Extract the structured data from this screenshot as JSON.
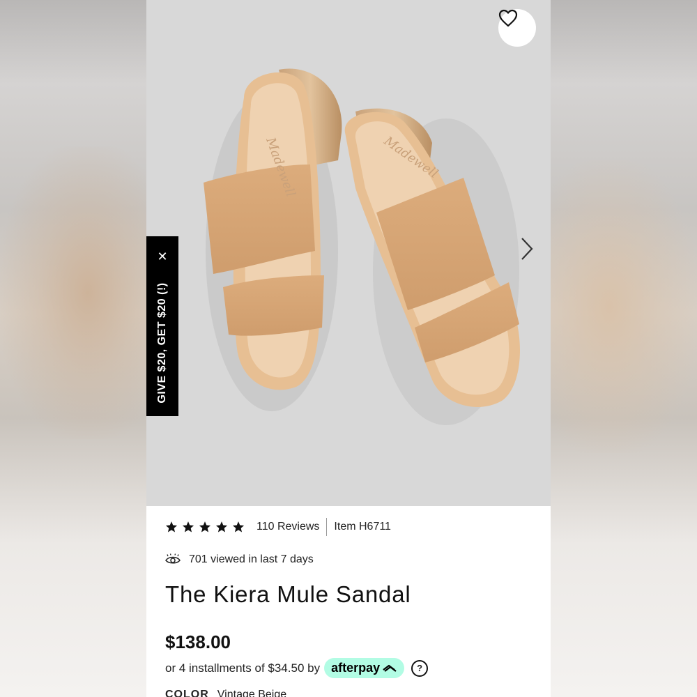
{
  "product": {
    "name": "The Kiera Mule Sandal",
    "price": "$138.00",
    "rating": 5,
    "reviews_label": "110 Reviews",
    "item_number": "Item H6711",
    "viewed": "701 viewed in last 7 days",
    "installments_text": "or 4 installments of $34.50 by",
    "afterpay_label": "afterpay",
    "color_label": "COLOR",
    "color_value": "Vintage Beige"
  },
  "promo": {
    "text": "GIVE $20, GET $20 (!)",
    "close_symbol": "✕"
  },
  "icons": {
    "favorite": "heart-icon",
    "next": "chevron-right-icon",
    "viewed": "eye-icon",
    "help": "question-icon",
    "star": "star-icon"
  },
  "colors": {
    "afterpay_mint": "#b2fce4",
    "hero_background": "#d8d8d8",
    "sandal_tan": "#d9a878"
  }
}
